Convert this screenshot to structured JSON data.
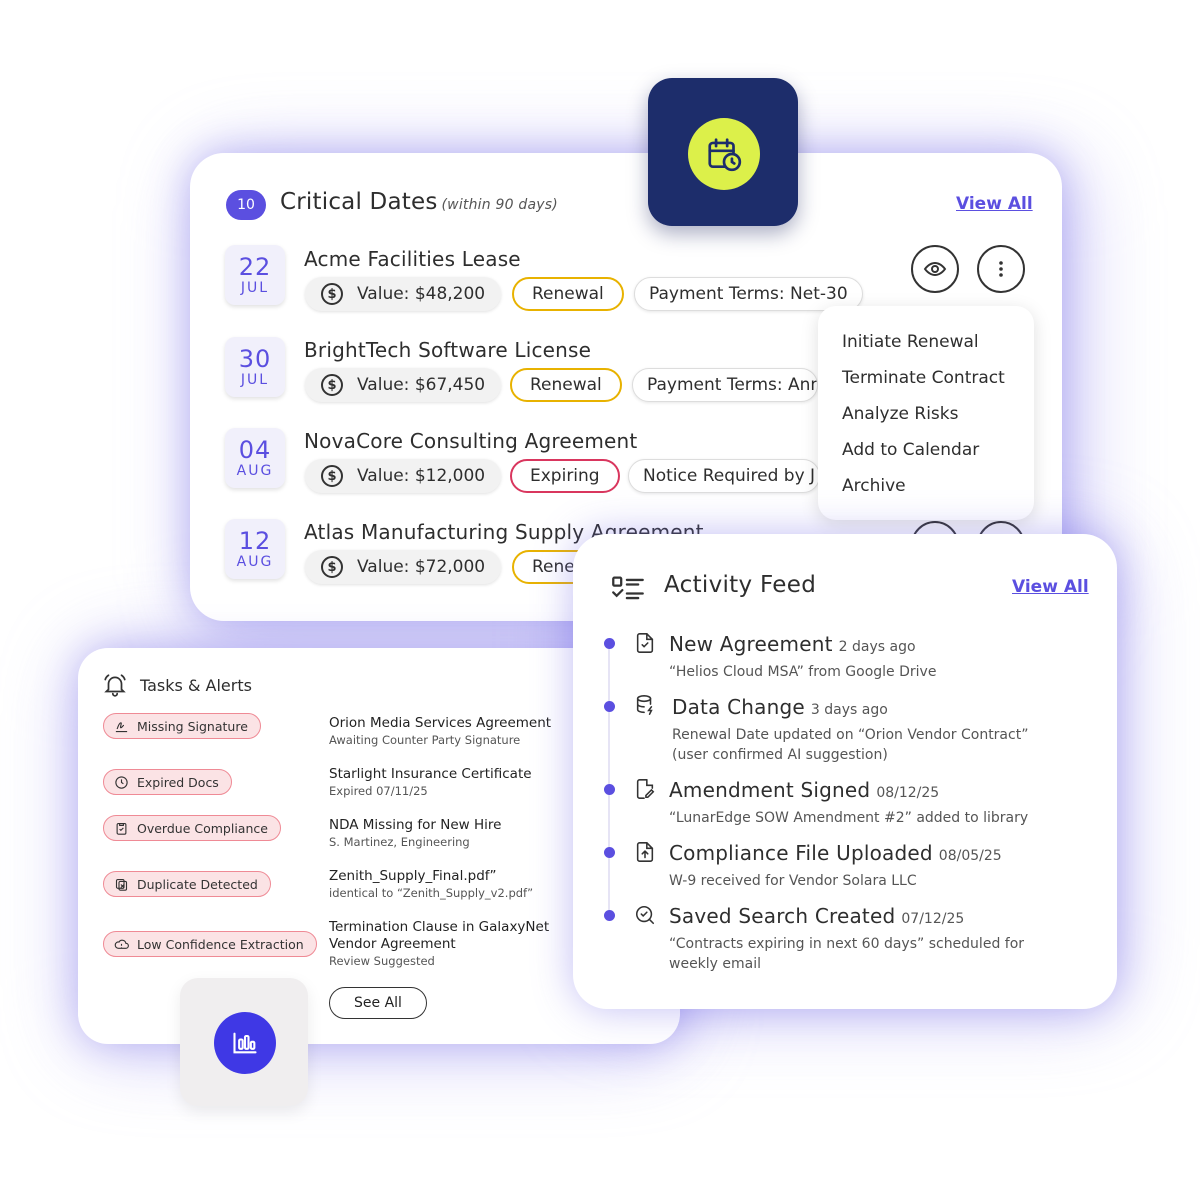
{
  "critical_dates": {
    "count": "10",
    "title": "Critical Dates",
    "subtitle": "(within 90 days)",
    "view_all": "View All",
    "rows": [
      {
        "day": "22",
        "month": "JUL",
        "title": "Acme Facilities Lease",
        "value": "Value: $48,200",
        "status": "Renewal",
        "terms": "Payment Terms: Net-30"
      },
      {
        "day": "30",
        "month": "JUL",
        "title": "BrightTech Software License",
        "value": "Value: $67,450",
        "status": "Renewal",
        "terms": "Payment Terms: Ann"
      },
      {
        "day": "04",
        "month": "AUG",
        "title": "NovaCore Consulting Agreement",
        "value": "Value: $12,000",
        "status": "Expiring",
        "terms": "Notice Required by J"
      },
      {
        "day": "12",
        "month": "AUG",
        "title": "Atlas Manufacturing Supply Agreement",
        "value": "Value: $72,000",
        "status": "Rene"
      }
    ],
    "menu": [
      "Initiate Renewal",
      "Terminate Contract",
      "Analyze Risks",
      "Add to Calendar",
      "Archive"
    ],
    "dollar_symbol": "$"
  },
  "tasks": {
    "title": "Tasks & Alerts",
    "items": [
      {
        "tag": "Missing Signature",
        "title": "Orion Media Services Agreement",
        "sub": "Awaiting Counter Party Signature"
      },
      {
        "tag": "Expired Docs",
        "title": "Starlight Insurance Certificate",
        "sub": "Expired 07/11/25"
      },
      {
        "tag": "Overdue Compliance",
        "title": "NDA Missing for New Hire",
        "sub": "S. Martinez, Engineering"
      },
      {
        "tag": "Duplicate Detected",
        "title": "Zenith_Supply_Final.pdf”",
        "sub": "identical to “Zenith_Supply_v2.pdf”"
      },
      {
        "tag": "Low Confidence Extraction",
        "title": "Termination Clause in GalaxyNet",
        "title2": "Vendor Agreement",
        "sub": "Review Suggested"
      }
    ],
    "see_all": "See All"
  },
  "feed": {
    "title": "Activity Feed",
    "view_all": "View All",
    "items": [
      {
        "name": "New Agreement",
        "time": "2 days ago",
        "desc": "“Helios Cloud MSA” from Google Drive"
      },
      {
        "name": "Data Change",
        "time": "3 days ago",
        "desc": "Renewal Date updated on “Orion Vendor Contract”",
        "desc2": "(user confirmed AI suggestion)"
      },
      {
        "name": "Amendment Signed",
        "time": "08/12/25",
        "desc": "“LunarEdge SOW Amendment #2” added to library"
      },
      {
        "name": "Compliance File Uploaded",
        "time": "08/05/25",
        "desc": "W-9 received for Vendor Solara LLC"
      },
      {
        "name": "Saved Search Created",
        "time": "07/12/25",
        "desc": "“Contracts expiring in next 60 days” scheduled for",
        "desc2": "weekly email"
      }
    ]
  },
  "colors": {
    "accent": "#5b4fe0",
    "renewal": "#e8b200",
    "expiring": "#d9365e",
    "alert_bg": "#fbe3e5",
    "navy": "#1d2d6b",
    "lime": "#dcf04a"
  },
  "icons": [
    "calendar-clock-icon",
    "eye-icon",
    "more-vertical-icon",
    "dollar-icon",
    "bell-icon",
    "chart-icon",
    "list-check-icon",
    "file-check-icon",
    "database-icon",
    "file-edit-icon",
    "file-upload-icon",
    "search-check-icon"
  ]
}
